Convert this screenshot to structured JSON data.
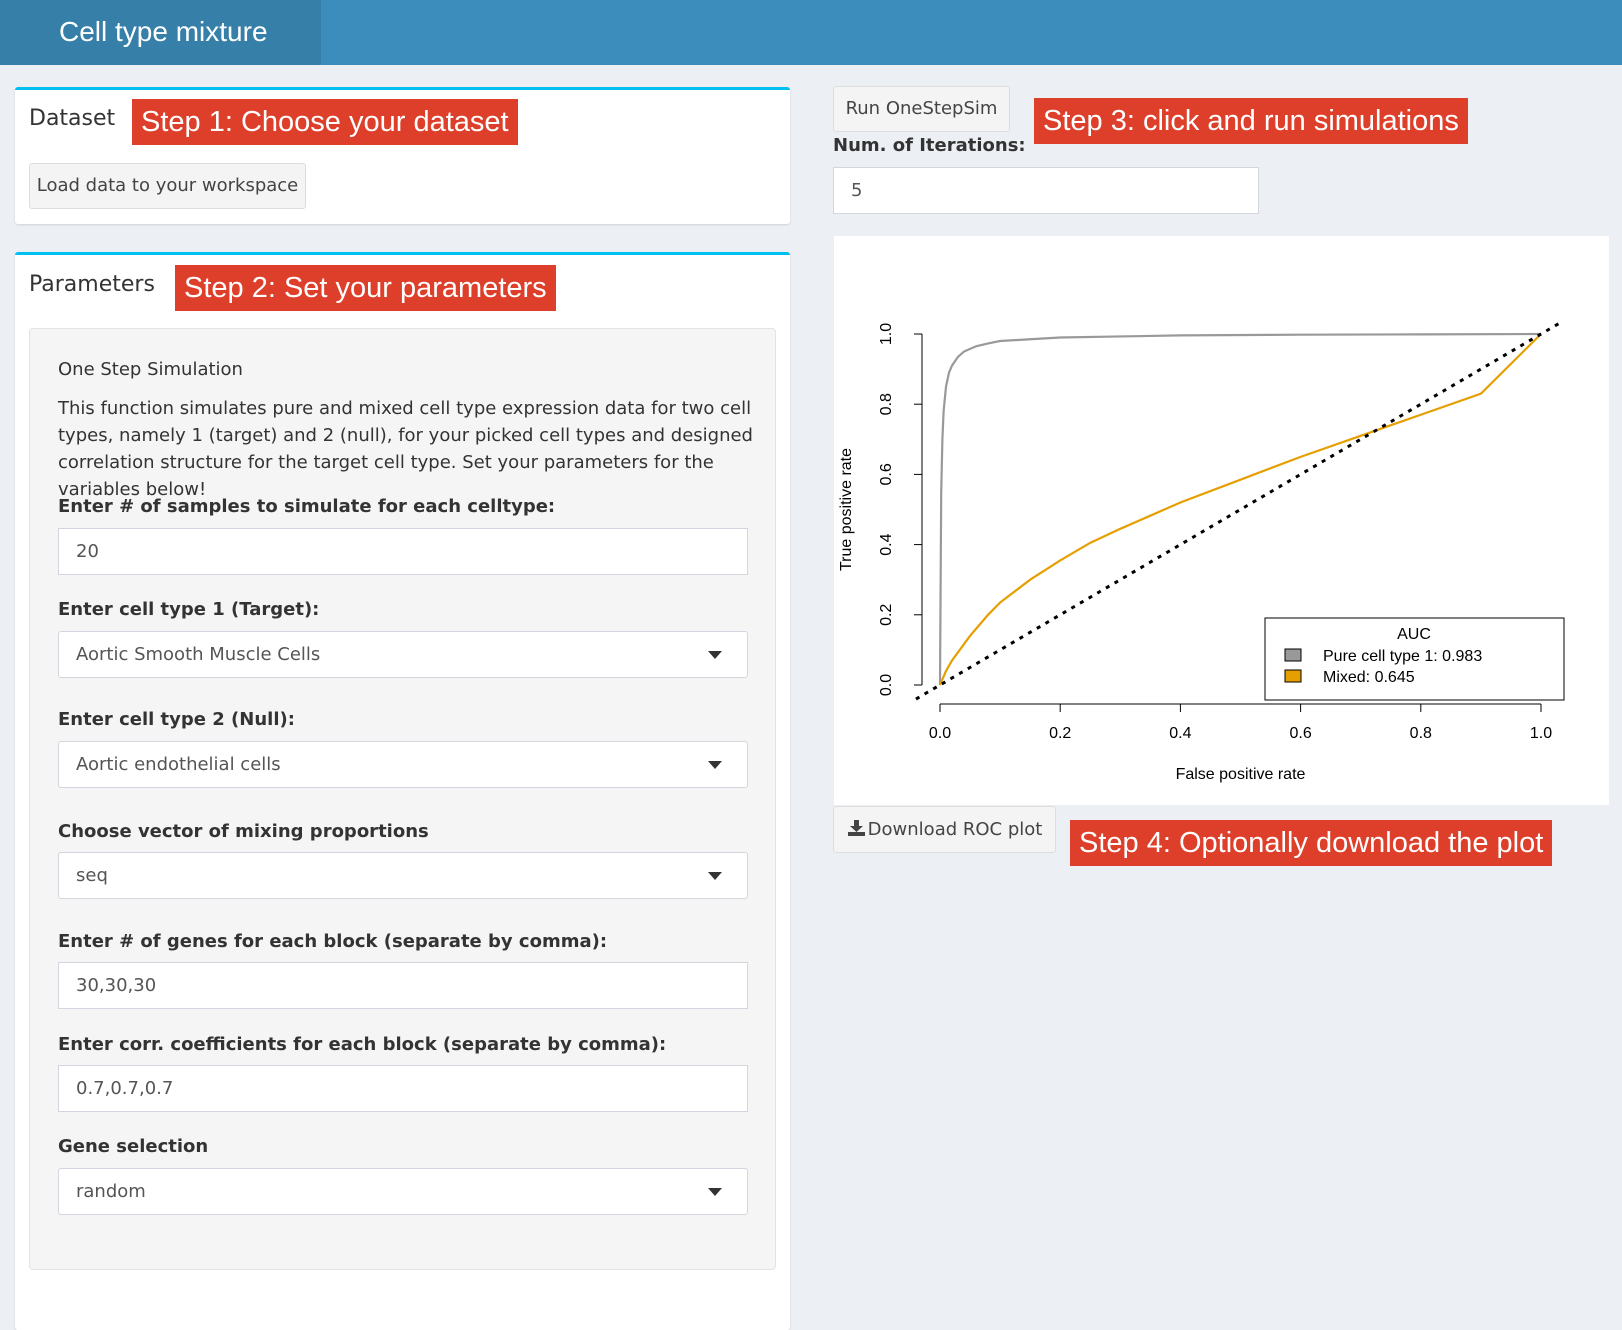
{
  "header": {
    "title": "Cell type mixture"
  },
  "dataset": {
    "title": "Dataset",
    "step": "Step 1: Choose your dataset",
    "load_button": "Load data to your workspace"
  },
  "params": {
    "title": "Parameters",
    "step": "Step 2: Set your parameters",
    "section_title": "One Step Simulation",
    "description": "This function simulates pure and mixed cell type expression data for two cell types, namely 1 (target) and 2 (null), for your picked cell types and designed correlation structure for the target cell type. Set your parameters for the variables below!",
    "samples_label": "Enter # of samples to simulate for each celltype:",
    "samples_value": "20",
    "celltype1_label": "Enter cell type 1 (Target):",
    "celltype1_value": "Aortic Smooth Muscle Cells",
    "celltype2_label": "Enter cell type 2 (Null):",
    "celltype2_value": "Aortic endothelial cells",
    "mixing_label": "Choose vector of mixing proportions",
    "mixing_value": "seq",
    "genes_label": "Enter # of genes for each block (separate by comma):",
    "genes_value": "30,30,30",
    "corr_label": "Enter corr. coefficients for each block (separate by comma):",
    "corr_value": "0.7,0.7,0.7",
    "gene_sel_label": "Gene selection",
    "gene_sel_value": "random"
  },
  "run": {
    "button": "Run OneStepSim",
    "step": "Step 3: click and run simulations",
    "iterations_label": "Num. of Iterations:",
    "iterations_value": "5"
  },
  "download": {
    "button": "Download ROC plot",
    "icon": "download-icon",
    "step": "Step 4: Optionally download the plot"
  },
  "colors": {
    "header": "#3c8dbc",
    "brand": "#367fa9",
    "box_top": "#00c0ef",
    "step_bg": "#dd3f2a",
    "pure_series": "#999999",
    "mixed_series": "#e69f00"
  },
  "chart_data": {
    "type": "line",
    "title": "",
    "xlabel": "False positive rate",
    "ylabel": "True positive rate",
    "xlim": [
      0,
      1
    ],
    "ylim": [
      0,
      1
    ],
    "xticks": [
      "0.0",
      "0.2",
      "0.4",
      "0.6",
      "0.8",
      "1.0"
    ],
    "yticks": [
      "0.0",
      "0.2",
      "0.4",
      "0.6",
      "0.8",
      "1.0"
    ],
    "grid": false,
    "legend": {
      "title": "AUC",
      "position": "bottom-right",
      "entries": [
        "Pure cell type 1: 0.983",
        "Mixed: 0.645"
      ]
    },
    "series": [
      {
        "name": "Pure cell type 1: 0.983",
        "color": "#999999",
        "x": [
          0,
          0.002,
          0.004,
          0.006,
          0.01,
          0.015,
          0.02,
          0.03,
          0.04,
          0.06,
          0.08,
          0.1,
          0.15,
          0.2,
          0.3,
          0.4,
          0.6,
          0.8,
          1.0
        ],
        "y": [
          0,
          0.55,
          0.7,
          0.78,
          0.85,
          0.89,
          0.91,
          0.935,
          0.95,
          0.965,
          0.973,
          0.98,
          0.985,
          0.99,
          0.993,
          0.996,
          0.998,
          0.999,
          1.0
        ]
      },
      {
        "name": "Mixed: 0.645",
        "color": "#e69f00",
        "x": [
          0,
          0.01,
          0.02,
          0.05,
          0.08,
          0.1,
          0.15,
          0.2,
          0.25,
          0.3,
          0.4,
          0.5,
          0.6,
          0.7,
          0.8,
          0.9,
          1.0
        ],
        "y": [
          0,
          0.04,
          0.07,
          0.14,
          0.2,
          0.235,
          0.3,
          0.355,
          0.405,
          0.445,
          0.52,
          0.585,
          0.65,
          0.71,
          0.77,
          0.83,
          1.0
        ]
      },
      {
        "name": "",
        "color": "#000000",
        "dashed": true,
        "x": [
          -0.04,
          1.03
        ],
        "y": [
          -0.04,
          1.03
        ]
      }
    ]
  }
}
